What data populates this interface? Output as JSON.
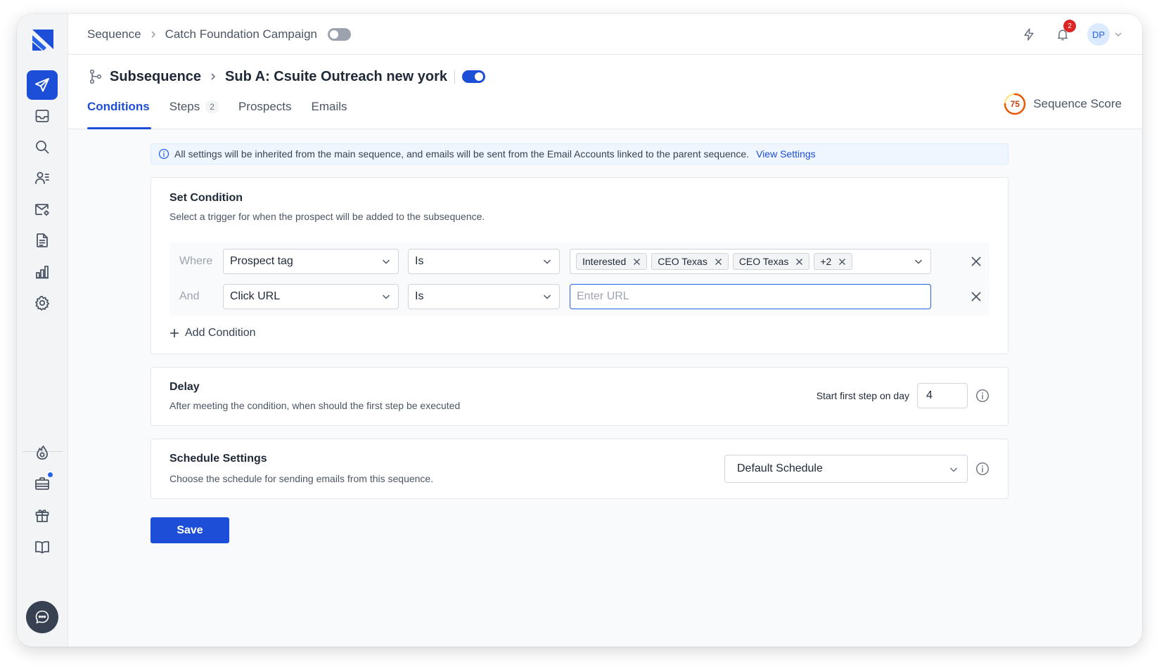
{
  "topbar": {
    "breadcrumb_root": "Sequence",
    "breadcrumb_campaign": "Catch Foundation Campaign",
    "campaign_toggle": "off",
    "notification_count": "2",
    "avatar_initials": "DP"
  },
  "header": {
    "title": "Subsequence",
    "subsequence_name": "Sub A: Csuite Outreach new york",
    "subsequence_toggle": "on",
    "tabs": [
      {
        "label": "Conditions",
        "active": true
      },
      {
        "label": "Steps",
        "count": "2"
      },
      {
        "label": "Prospects"
      },
      {
        "label": "Emails"
      }
    ],
    "score_value": "75",
    "score_label": "Sequence Score"
  },
  "banner": {
    "text": "All settings will be inherited from the main sequence, and emails will be sent from the Email Accounts linked to the parent sequence.",
    "link": "View Settings"
  },
  "condition": {
    "title": "Set Condition",
    "description": "Select a trigger for when the prospect will be added to the subsequence.",
    "rows": [
      {
        "label": "Where",
        "field": "Prospect tag",
        "operator": "Is",
        "tags": [
          "Interested",
          "CEO Texas",
          "CEO Texas",
          "+2"
        ]
      },
      {
        "label": "And",
        "field": "Click URL",
        "operator": "Is",
        "placeholder": "Enter URL"
      }
    ],
    "add_label": "Add Condition"
  },
  "delay": {
    "title": "Delay",
    "description": "After meeting the condition, when should the first step be executed",
    "start_label": "Start first step on day",
    "day_value": "4"
  },
  "schedule": {
    "title": "Schedule Settings",
    "description": "Choose the schedule for sending emails from this sequence.",
    "selected": "Default Schedule"
  },
  "save_label": "Save",
  "colors": {
    "accent": "#1d4ed8",
    "notification": "#dc2626",
    "score": "#c2410c"
  }
}
